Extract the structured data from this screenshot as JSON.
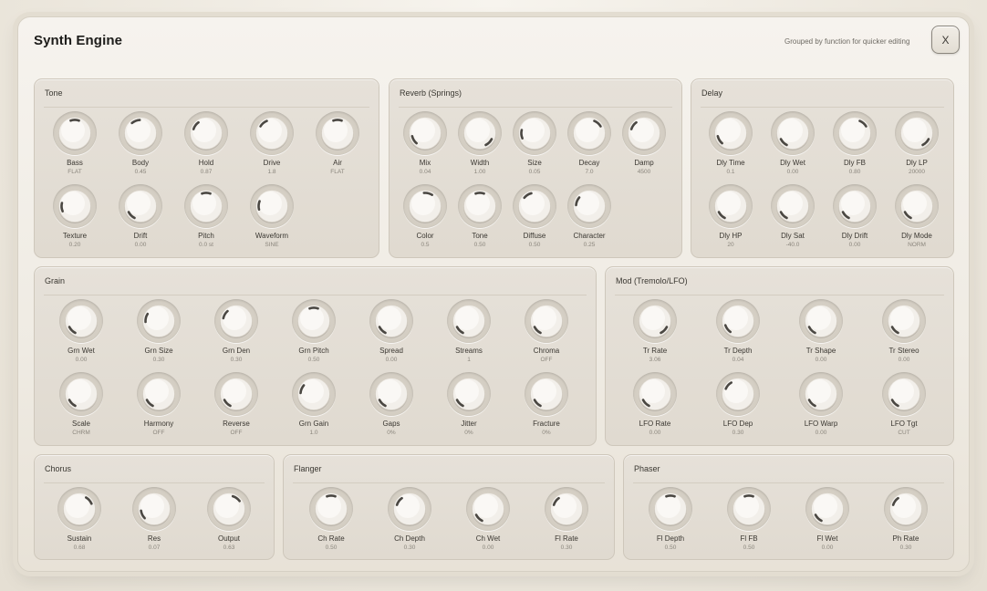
{
  "window": {
    "title": "Synth Engine",
    "subtitle": "Grouped by function for quicker editing",
    "close_label": "X"
  },
  "colors": {
    "indicator": "#4a4742",
    "panel": "#e4dfd7",
    "background": "#ece7dd"
  },
  "sections": [
    {
      "id": "tone",
      "title": "Tone",
      "knobs": [
        {
          "label": "Bass",
          "value": "FLAT",
          "level": 0.5
        },
        {
          "label": "Body",
          "value": "0.45",
          "level": 0.42
        },
        {
          "label": "Hold",
          "value": "0.87",
          "level": 0.3
        },
        {
          "label": "Drive",
          "value": "1.8",
          "level": 0.35
        },
        {
          "label": "Air",
          "value": "FLAT",
          "level": 0.5
        },
        {
          "label": "Texture",
          "value": "0.20",
          "level": 0.15
        },
        {
          "label": "Drift",
          "value": "0.00",
          "level": 0.0
        },
        {
          "label": "Pitch",
          "value": "0.0 st",
          "level": 0.5
        },
        {
          "label": "Waveform",
          "value": "SINE",
          "level": 0.18
        }
      ]
    },
    {
      "id": "reverb",
      "title": "Reverb (Springs)",
      "knobs": [
        {
          "label": "Mix",
          "value": "0.04",
          "level": 0.05
        },
        {
          "label": "Width",
          "value": "1.00",
          "level": 1.0
        },
        {
          "label": "Size",
          "value": "0.05",
          "level": 0.15
        },
        {
          "label": "Decay",
          "value": "7.0",
          "level": 0.65
        },
        {
          "label": "Damp",
          "value": "4500",
          "level": 0.3
        },
        {
          "label": "Color",
          "value": "0.5",
          "level": 0.55
        },
        {
          "label": "Tone",
          "value": "0.50",
          "level": 0.5
        },
        {
          "label": "Diffuse",
          "value": "0.50",
          "level": 0.38
        },
        {
          "label": "Character",
          "value": "0.25",
          "level": 0.25
        }
      ]
    },
    {
      "id": "delay",
      "title": "Delay",
      "knobs": [
        {
          "label": "Dly Time",
          "value": "0.1",
          "level": 0.05
        },
        {
          "label": "Dly Wet",
          "value": "0.00",
          "level": 0.0
        },
        {
          "label": "Dly FB",
          "value": "0.80",
          "level": 0.65
        },
        {
          "label": "Dly LP",
          "value": "20000",
          "level": 1.0
        },
        {
          "label": "Dly HP",
          "value": "20",
          "level": 0.0
        },
        {
          "label": "Dly Sat",
          "value": "-40.0",
          "level": 0.0
        },
        {
          "label": "Dly Drift",
          "value": "0.00",
          "level": 0.0
        },
        {
          "label": "Dly Mode",
          "value": "NORM",
          "level": 0.0
        }
      ]
    },
    {
      "id": "grain",
      "title": "Grain",
      "knobs": [
        {
          "label": "Grn Wet",
          "value": "0.00",
          "level": 0.0
        },
        {
          "label": "Grn Size",
          "value": "0.30",
          "level": 0.22
        },
        {
          "label": "Grn Den",
          "value": "0.30",
          "level": 0.28
        },
        {
          "label": "Grn Pitch",
          "value": "0.50",
          "level": 0.5
        },
        {
          "label": "Spread",
          "value": "0.00",
          "level": 0.0
        },
        {
          "label": "Streams",
          "value": "1",
          "level": 0.0
        },
        {
          "label": "Chroma",
          "value": "OFF",
          "level": 0.0
        },
        {
          "label": "Scale",
          "value": "CHRM",
          "level": 0.0
        },
        {
          "label": "Harmony",
          "value": "OFF",
          "level": 0.0
        },
        {
          "label": "Reverse",
          "value": "OFF",
          "level": 0.0
        },
        {
          "label": "Grn Gain",
          "value": "1.0",
          "level": 0.25
        },
        {
          "label": "Gaps",
          "value": "0%",
          "level": 0.0
        },
        {
          "label": "Jitter",
          "value": "0%",
          "level": 0.0
        },
        {
          "label": "Fracture",
          "value": "0%",
          "level": 0.0
        }
      ]
    },
    {
      "id": "mod",
      "title": "Mod (Tremolo/LFO)",
      "knobs": [
        {
          "label": "Tr Rate",
          "value": "3.06",
          "level": 1.0
        },
        {
          "label": "Tr Depth",
          "value": "0.04",
          "level": 0.03
        },
        {
          "label": "Tr Shape",
          "value": "0.00",
          "level": 0.0
        },
        {
          "label": "Tr Stereo",
          "value": "0.00",
          "level": 0.0
        },
        {
          "label": "LFO Rate",
          "value": "0.00",
          "level": 0.0
        },
        {
          "label": "LFO Dep",
          "value": "0.30",
          "level": 0.32
        },
        {
          "label": "LFO Warp",
          "value": "0.00",
          "level": 0.0
        },
        {
          "label": "LFO Tgt",
          "value": "CUT",
          "level": 0.0
        }
      ]
    },
    {
      "id": "chorus",
      "title": "Chorus",
      "knobs": [
        {
          "label": "Sustain",
          "value": "0.68",
          "level": 0.68
        },
        {
          "label": "Res",
          "value": "0.07",
          "level": 0.07
        },
        {
          "label": "Output",
          "value": "0.63",
          "level": 0.63
        }
      ]
    },
    {
      "id": "flanger",
      "title": "Flanger",
      "knobs": [
        {
          "label": "Ch Rate",
          "value": "0.50",
          "level": 0.5
        },
        {
          "label": "Ch Depth",
          "value": "0.30",
          "level": 0.3
        },
        {
          "label": "Ch Wet",
          "value": "0.00",
          "level": 0.0
        },
        {
          "label": "Fl Rate",
          "value": "0.30",
          "level": 0.3
        }
      ]
    },
    {
      "id": "phaser",
      "title": "Phaser",
      "knobs": [
        {
          "label": "Fl Depth",
          "value": "0.50",
          "level": 0.5
        },
        {
          "label": "Fl FB",
          "value": "0.50",
          "level": 0.5
        },
        {
          "label": "Fl Wet",
          "value": "0.00",
          "level": 0.0
        },
        {
          "label": "Ph Rate",
          "value": "0.30",
          "level": 0.3
        }
      ]
    }
  ]
}
